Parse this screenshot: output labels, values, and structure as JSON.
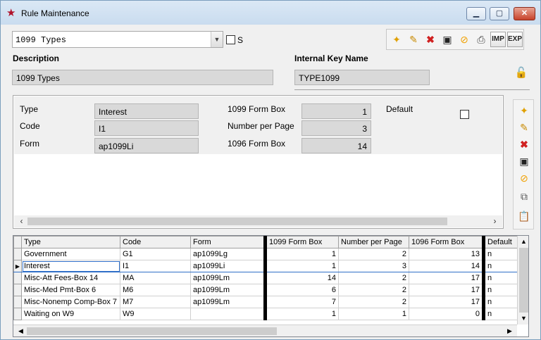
{
  "window": {
    "title": "Rule Maintenance",
    "icon": "star-icon"
  },
  "header": {
    "rule_select": "1099 Types",
    "s_label": "S",
    "description_label": "Description",
    "description_value": "1099 Types",
    "internal_key_label": "Internal Key Name",
    "internal_key_value": "TYPE1099"
  },
  "toolbar": {
    "buttons": [
      "new-icon",
      "edit-icon",
      "delete-icon",
      "save-icon",
      "cancel-icon",
      "print-icon"
    ],
    "imp_label": "IMP",
    "exp_label": "EXP"
  },
  "detail": {
    "type_label": "Type",
    "type_value": "Interest",
    "code_label": "Code",
    "code_value": "I1",
    "form_label": "Form",
    "form_value": "ap1099Li",
    "form_box_label": "1099 Form Box",
    "form_box_value": "1",
    "per_page_label": "Number per Page",
    "per_page_value": "3",
    "box_1096_label": "1096 Form Box",
    "box_1096_value": "14",
    "default_label": "Default"
  },
  "grid": {
    "columns": [
      "Type",
      "Code",
      "Form",
      "1099 Form Box",
      "Number per Page",
      "1096 Form Box",
      "Default"
    ],
    "rows": [
      [
        "Government",
        "G1",
        "ap1099Lg",
        "1",
        "2",
        "13",
        "n"
      ],
      [
        "Interest",
        "I1",
        "ap1099Li",
        "1",
        "3",
        "14",
        "n"
      ],
      [
        "Misc-Att Fees-Box 14",
        "MA",
        "ap1099Lm",
        "14",
        "2",
        "17",
        "n"
      ],
      [
        "Misc-Med Pmt-Box 6",
        "M6",
        "ap1099Lm",
        "6",
        "2",
        "17",
        "n"
      ],
      [
        "Misc-Nonemp Comp-Box 7",
        "M7",
        "ap1099Lm",
        "7",
        "2",
        "17",
        "n"
      ],
      [
        "Waiting on W9",
        "W9",
        "",
        "1",
        "1",
        "0",
        "n"
      ]
    ],
    "current_row": 1
  },
  "colors": {
    "accent": "#2f6fc8",
    "close": "#c7422b",
    "lock": "#1d8a1d"
  }
}
